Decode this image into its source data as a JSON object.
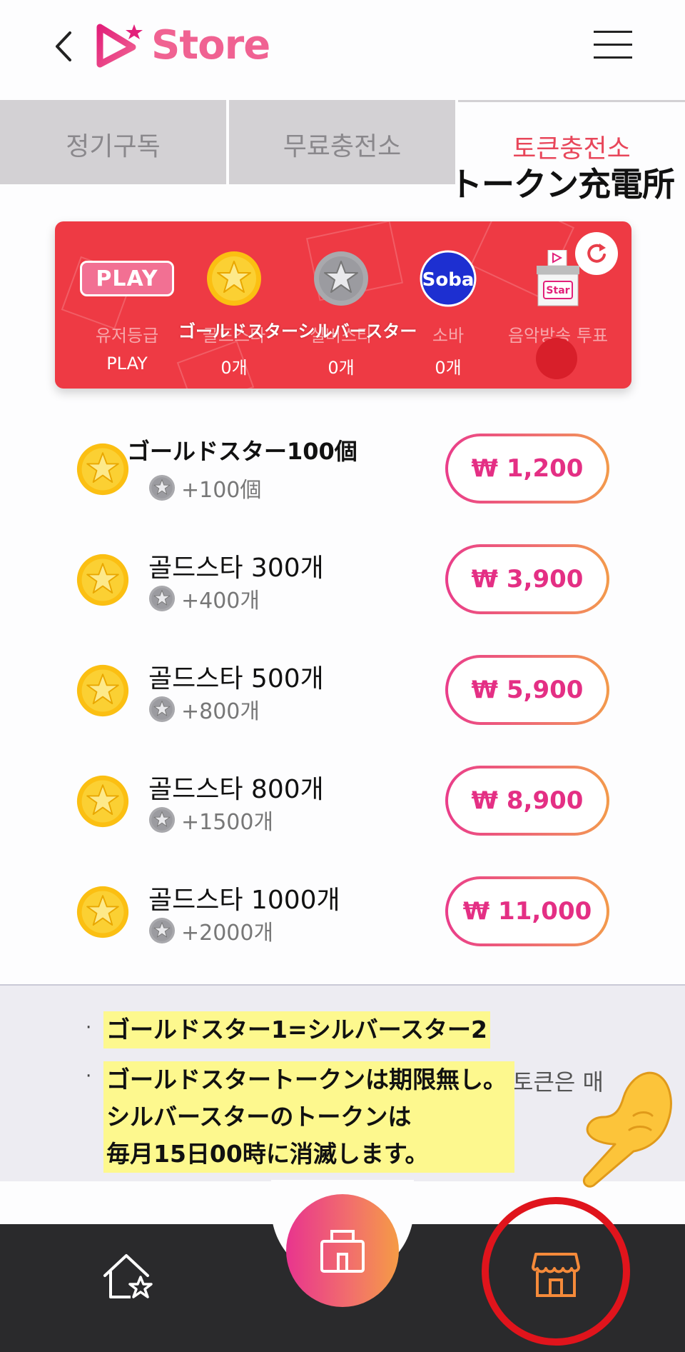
{
  "header": {
    "brand": "Store",
    "colors": {
      "brand_pink": "#f06292",
      "accent_red": "#e8465a"
    }
  },
  "tabs": [
    {
      "label": "정기구독",
      "active": false
    },
    {
      "label": "무료충전소",
      "active": false
    },
    {
      "label": "토큰충전소",
      "active": true,
      "overlay": "トークン充電所"
    }
  ],
  "balance_card": {
    "columns": [
      {
        "icon": "play-badge",
        "badge_text": "PLAY",
        "label": "유저등급",
        "value": "PLAY"
      },
      {
        "icon": "gold-star-icon",
        "label": "골드스타",
        "value": "0개"
      },
      {
        "icon": "silver-star-icon",
        "label": "실버스타",
        "value": "0개"
      },
      {
        "icon": "soba-icon",
        "badge_text": "Soba",
        "label": "소바",
        "value": "0개"
      },
      {
        "icon": "ballot-box-icon",
        "badge_text": "Star",
        "label": "음악방송 투표",
        "value": ""
      }
    ],
    "overlay": "ゴールドスターシルバースター"
  },
  "products": [
    {
      "title": "ゴールドスター100個",
      "bonus": "+100個",
      "price": "₩ 1,200"
    },
    {
      "title": "골드스타 300개",
      "bonus": "+400개",
      "price": "₩ 3,900"
    },
    {
      "title": "골드스타 500개",
      "bonus": "+800개",
      "price": "₩ 5,900"
    },
    {
      "title": "골드스타 800개",
      "bonus": "+1500개",
      "price": "₩ 8,900"
    },
    {
      "title": "골드스타 1000개",
      "bonus": "+2000개",
      "price": "₩ 11,000"
    }
  ],
  "notes": {
    "bullet": "·",
    "line1": "ゴールドスター1=シルバースター2",
    "line2": "ゴールドスタートークンは期限無し。",
    "line3": "シルバースターのトークンは",
    "line4": "毎月15日00時に消滅します。",
    "tail": "토큰은 매"
  },
  "nav": {
    "items": [
      "home-icon",
      "store-center-icon",
      "store-icon"
    ],
    "colors": {
      "nav_bg": "#2a2a2c",
      "highlight": "#e0141c"
    }
  }
}
